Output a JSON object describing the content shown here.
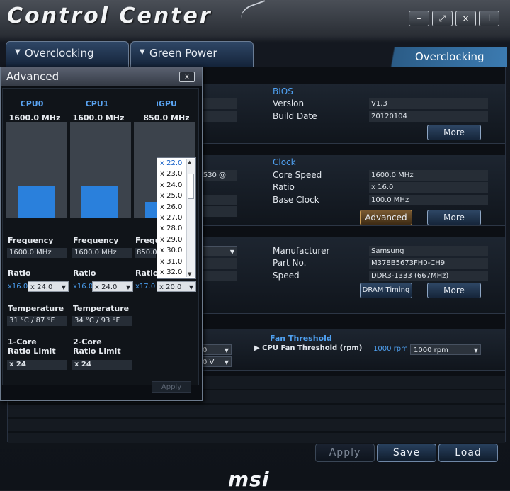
{
  "app": {
    "title": "Control Center"
  },
  "window_buttons": [
    "–",
    "⤢",
    "×",
    "i"
  ],
  "tabs": [
    {
      "label": "Overclocking"
    },
    {
      "label": "Green Power"
    }
  ],
  "active_section": "Overclocking",
  "bios": {
    "header": "BIOS",
    "version_label": "Version",
    "version_value": "V1.3",
    "date_label": "Build Date",
    "date_value": "20120104",
    "more": "More"
  },
  "clock": {
    "header": "Clock",
    "core_label": "Core Speed",
    "core_value": "1600.0 MHz",
    "ratio_label": "Ratio",
    "ratio_value": "x 16.0",
    "base_label": "Base Clock",
    "base_value": "100.0 MHz",
    "advanced": "Advanced",
    "more": "More",
    "partial_cpu_text": "i530 @"
  },
  "memory": {
    "mfr_label": "Manufacturer",
    "mfr_value": "Samsung",
    "part_label": "Part No.",
    "part_value": "M378B5673FH0-CH9",
    "speed_label": "Speed",
    "speed_value": "DDR3-1333 (667MHz)",
    "dram_timing": "DRAM Timing",
    "more": "More"
  },
  "fan": {
    "header": "Fan Threshold",
    "cpu_label": "CPU Fan Threshold (rpm)",
    "cpu_value": "1000 rpm",
    "cpu_select": "1000 rpm",
    "partial_a": "0",
    "partial_b": "0 V"
  },
  "footer": {
    "apply": "Apply",
    "save": "Save",
    "load": "Load",
    "logo": "msi"
  },
  "advanced_popup": {
    "title": "Advanced",
    "close": "x",
    "columns": [
      {
        "name": "CPU0",
        "speed": "1600.0 MHz",
        "freq_label": "Frequency",
        "freq_value": "1600.0 MHz",
        "ratio_label": "Ratio",
        "ratio_cur": "x16.0",
        "ratio_sel": "x 24.0",
        "temp_label": "Temperature",
        "temp_value": "31 °C / 87 °F",
        "limit_label_1": "1-Core",
        "limit_label_2": "Ratio Limit",
        "limit_value": "x 24",
        "load_fraction": 0.33
      },
      {
        "name": "CPU1",
        "speed": "1600.0 MHz",
        "freq_label": "Frequency",
        "freq_value": "1600.0 MHz",
        "ratio_label": "Ratio",
        "ratio_cur": "x16.0",
        "ratio_sel": "x 24.0",
        "temp_label": "Temperature",
        "temp_value": "34 °C / 93 °F",
        "limit_label_1": "2-Core",
        "limit_label_2": "Ratio Limit",
        "limit_value": "x 24",
        "load_fraction": 0.33
      },
      {
        "name": "iGPU",
        "speed": "850.0 MHz",
        "freq_label": "Frequ",
        "freq_value": "850.0",
        "ratio_label": "Ratio",
        "ratio_cur": "x17.0",
        "ratio_sel": "x 20.0",
        "load_fraction": 0.17
      }
    ],
    "dropdown_options": [
      "x 22.0",
      "x 23.0",
      "x 24.0",
      "x 25.0",
      "x 26.0",
      "x 27.0",
      "x 28.0",
      "x 29.0",
      "x 30.0",
      "x 31.0",
      "x 32.0"
    ],
    "apply": "Apply"
  }
}
